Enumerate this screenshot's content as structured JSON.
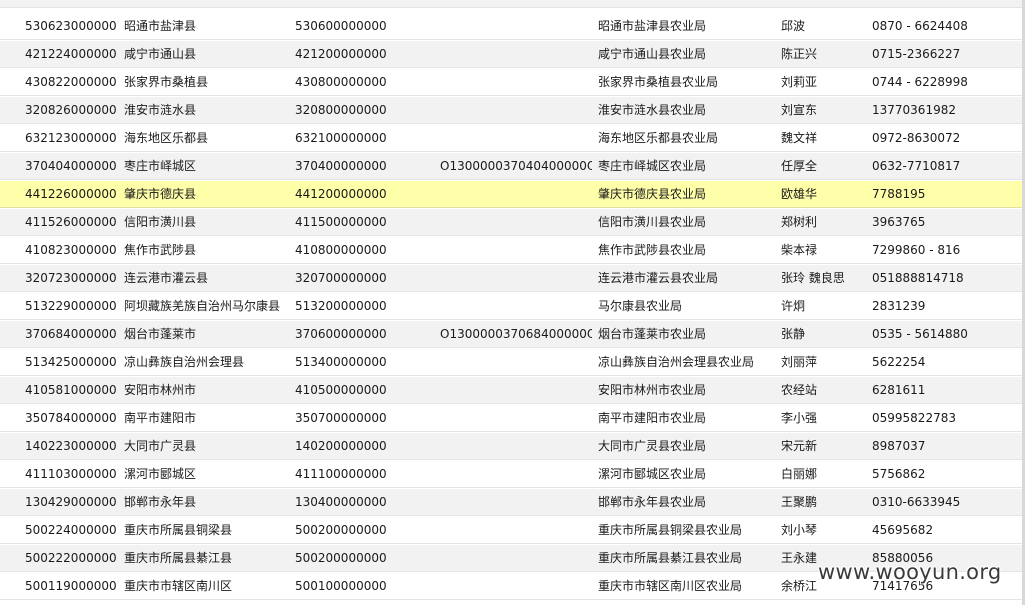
{
  "table": {
    "partial_row": [
      "",
      "昭通市盐津县农业局",
      ""
    ],
    "rows": [
      [
        "530623000000",
        "昭通市盐津县",
        "530600000000",
        "",
        "昭通市盐津县农业局",
        "邱波",
        "0870 - 6624408"
      ],
      [
        "421224000000",
        "咸宁市通山县",
        "421200000000",
        "",
        "咸宁市通山县农业局",
        "陈正兴",
        "0715-2366227"
      ],
      [
        "430822000000",
        "张家界市桑植县",
        "430800000000",
        "",
        "张家界市桑植县农业局",
        "刘莉亚",
        "0744 - 6228998"
      ],
      [
        "320826000000",
        "淮安市涟水县",
        "320800000000",
        "",
        "淮安市涟水县农业局",
        "刘宣东",
        "13770361982"
      ],
      [
        "632123000000",
        "海东地区乐都县",
        "632100000000",
        "",
        "海东地区乐都县农业局",
        "魏文祥",
        "0972-8630072"
      ],
      [
        "370404000000",
        "枣庄市峄城区",
        "370400000000",
        "O130000037040400000O",
        "枣庄市峄城区农业局",
        "任厚全",
        "0632-7710817"
      ],
      [
        "441226000000",
        "肇庆市德庆县",
        "441200000000",
        "",
        "肇庆市德庆县农业局",
        "欧雄华",
        "7788195"
      ],
      [
        "411526000000",
        "信阳市潢川县",
        "411500000000",
        "",
        "信阳市潢川县农业局",
        "郑树利",
        "3963765"
      ],
      [
        "410823000000",
        "焦作市武陟县",
        "410800000000",
        "",
        "焦作市武陟县农业局",
        "柴本禄",
        "7299860 - 816"
      ],
      [
        "320723000000",
        "连云港市灌云县",
        "320700000000",
        "",
        "连云港市灌云县农业局",
        "张玲 魏良思",
        "051888814718"
      ],
      [
        "513229000000",
        "阿坝藏族羌族自治州马尔康县",
        "513200000000",
        "",
        "马尔康县农业局",
        "许炯",
        "2831239"
      ],
      [
        "370684000000",
        "烟台市蓬莱市",
        "370600000000",
        "O130000037068400000O",
        "烟台市蓬莱市农业局",
        "张静",
        "0535 - 5614880"
      ],
      [
        "513425000000",
        "凉山彝族自治州会理县",
        "513400000000",
        "",
        "凉山彝族自治州会理县农业局",
        "刘丽萍",
        "5622254"
      ],
      [
        "410581000000",
        "安阳市林州市",
        "410500000000",
        "",
        "安阳市林州市农业局",
        "农经站",
        "6281611"
      ],
      [
        "350784000000",
        "南平市建阳市",
        "350700000000",
        "",
        "南平市建阳市农业局",
        "李小强",
        "05995822783"
      ],
      [
        "140223000000",
        "大同市广灵县",
        "140200000000",
        "",
        "大同市广灵县农业局",
        "宋元新",
        "8987037"
      ],
      [
        "411103000000",
        "漯河市郾城区",
        "411100000000",
        "",
        "漯河市郾城区农业局",
        "白丽娜",
        "5756862"
      ],
      [
        "130429000000",
        "邯郸市永年县",
        "130400000000",
        "",
        "邯郸市永年县农业局",
        "王聚鹏",
        "0310-6633945"
      ],
      [
        "500224000000",
        "重庆市所属县铜梁县",
        "500200000000",
        "",
        "重庆市所属县铜梁县农业局",
        "刘小琴",
        "45695682"
      ],
      [
        "500222000000",
        "重庆市所属县綦江县",
        "500200000000",
        "",
        "重庆市所属县綦江县农业局",
        "王永建",
        "85880056"
      ],
      [
        "500119000000",
        "重庆市市辖区南川区",
        "500100000000",
        "",
        "重庆市市辖区南川区农业局",
        "余桥江",
        "71417656"
      ]
    ],
    "selected_row_index": 6,
    "row_colors": {
      "normal": "#ffffff",
      "alternate": "#f2f2f2",
      "selected": "#ffffaa"
    }
  },
  "watermark": {
    "text": "www.wooyun.org"
  }
}
